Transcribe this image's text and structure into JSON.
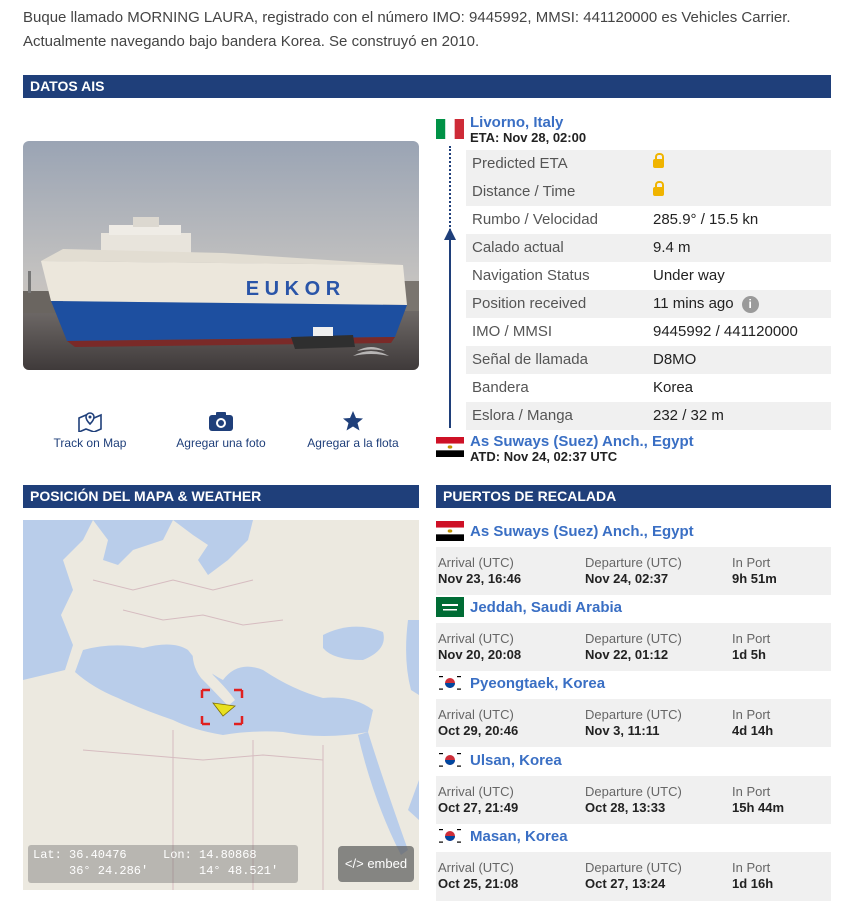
{
  "intro": "Buque llamado MORNING LAURA, registrado con el número IMO: 9445992, MMSI: 441120000 es Vehicles Carrier. Actualmente navegando bajo bandera Korea. Se construyó en 2010.",
  "sections": {
    "ais": "DATOS AIS",
    "map": "POSICIÓN DEL MAPA & WEATHER",
    "ports": "PUERTOS DE RECALADA"
  },
  "photo": {
    "hull_text": "E U K O R"
  },
  "actions": {
    "track": {
      "label": "Track on Map",
      "icon": "map-pin-icon"
    },
    "photo": {
      "label": "Agregar una foto",
      "icon": "camera-icon"
    },
    "fleet": {
      "label": "Agregar a la flota",
      "icon": "star-icon"
    }
  },
  "destination": {
    "name": "Livorno, Italy",
    "sub": "ETA: Nov 28, 02:00",
    "flag": "italy"
  },
  "origin": {
    "name": "As Suways (Suez) Anch., Egypt",
    "sub": "ATD: Nov 24, 02:37 UTC",
    "flag": "egypt"
  },
  "ais_rows": [
    {
      "key": "Predicted ETA",
      "value": "",
      "locked": true
    },
    {
      "key": "Distance / Time",
      "value": "",
      "locked": true
    },
    {
      "key": "Rumbo / Velocidad",
      "value": "285.9° / 15.5 kn"
    },
    {
      "key": "Calado actual",
      "value": "9.4 m"
    },
    {
      "key": "Navigation Status",
      "value": "Under way"
    },
    {
      "key": "Position received",
      "value": "11 mins ago",
      "info": "i"
    },
    {
      "key": "IMO / MMSI",
      "value": "9445992 / 441120000"
    },
    {
      "key": "Señal de llamada",
      "value": "D8MO"
    },
    {
      "key": "Bandera",
      "value": "Korea"
    },
    {
      "key": "Eslora / Manga",
      "value": "232 / 32 m"
    }
  ],
  "map": {
    "lat_label": "Lat:",
    "lat_dec": "36.40476",
    "lat_dms": "36° 24.286′",
    "lon_label": "Lon:",
    "lon_dec": "14.80868",
    "lon_dms": "14° 48.521′",
    "embed": "</> embed"
  },
  "ports_of_call": {
    "arrival_label": "Arrival (UTC)",
    "departure_label": "Departure (UTC)",
    "inport_label": "In Port",
    "items": [
      {
        "name": "As Suways (Suez) Anch., Egypt",
        "flag": "egypt",
        "arrival": "Nov 23, 16:46",
        "departure": "Nov 24, 02:37",
        "in_port": "9h 51m"
      },
      {
        "name": "Jeddah, Saudi Arabia",
        "flag": "saudi",
        "arrival": "Nov 20, 20:08",
        "departure": "Nov 22, 01:12",
        "in_port": "1d 5h"
      },
      {
        "name": "Pyeongtaek, Korea",
        "flag": "korea",
        "arrival": "Oct 29, 20:46",
        "departure": "Nov 3, 11:11",
        "in_port": "4d 14h"
      },
      {
        "name": "Ulsan, Korea",
        "flag": "korea",
        "arrival": "Oct 27, 21:49",
        "departure": "Oct 28, 13:33",
        "in_port": "15h 44m"
      },
      {
        "name": "Masan, Korea",
        "flag": "korea",
        "arrival": "Oct 25, 21:08",
        "departure": "Oct 27, 13:24",
        "in_port": "1d 16h"
      }
    ]
  },
  "colors": {
    "header": "#1f3f7a",
    "link": "#3a6fc4",
    "lock": "#f0b400",
    "sea": "#b9cdea",
    "land": "#ece9e0"
  }
}
